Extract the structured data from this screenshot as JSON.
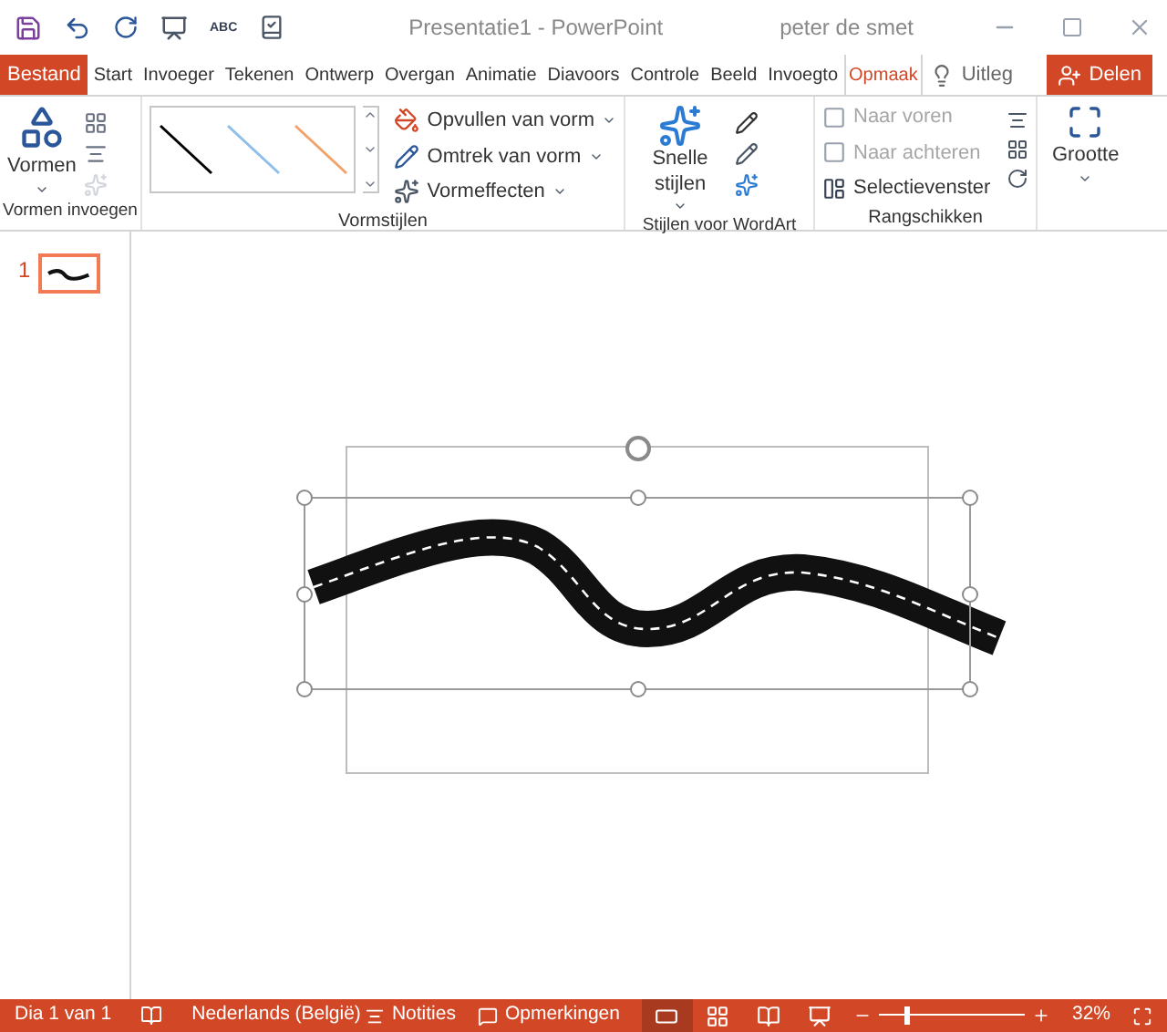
{
  "window": {
    "title": "Presentatie1 - PowerPoint",
    "user": "peter de smet",
    "spelling_label": "ABC"
  },
  "tabs": [
    {
      "label": "Bestand",
      "kind": "file",
      "selected": false
    },
    {
      "label": "Start",
      "kind": "tab",
      "selected": false
    },
    {
      "label": "Invoeger",
      "kind": "tab",
      "selected": false
    },
    {
      "label": "Tekenen",
      "kind": "tab",
      "selected": false
    },
    {
      "label": "Ontwerp",
      "kind": "tab",
      "selected": false
    },
    {
      "label": "Overgan",
      "kind": "tab",
      "selected": false
    },
    {
      "label": "Animatie",
      "kind": "tab",
      "selected": false
    },
    {
      "label": "Diavoors",
      "kind": "tab",
      "selected": false
    },
    {
      "label": "Controle",
      "kind": "tab",
      "selected": false
    },
    {
      "label": "Beeld",
      "kind": "tab",
      "selected": false
    },
    {
      "label": "Invoegto",
      "kind": "tab",
      "selected": false
    },
    {
      "label": "Opmaak",
      "kind": "tab",
      "selected": true
    },
    {
      "label": "Uitleg",
      "kind": "tell",
      "selected": false
    }
  ],
  "share_button": "Delen",
  "ribbon": {
    "insert_shapes": {
      "label": "Vormen invoegen",
      "shapes_button": "Vormen"
    },
    "shape_styles": {
      "label": "Vormstijlen",
      "gallery": [
        {
          "color": "#000000"
        },
        {
          "color": "#8fbfe8"
        },
        {
          "color": "#f2a36b"
        }
      ],
      "commands": [
        {
          "label": "Opvullen van vorm",
          "kind": "fill"
        },
        {
          "label": "Omtrek van vorm",
          "kind": "outline"
        },
        {
          "label": "Vormeffecten",
          "kind": "effects"
        }
      ]
    },
    "wordart_styles": {
      "label": "Stijlen voor WordArt",
      "quick_styles": "Snelle stijlen"
    },
    "arrange": {
      "label": "Rangschikken",
      "commands": [
        {
          "label": "Naar voren",
          "kind": "forward",
          "disabled": true
        },
        {
          "label": "Naar achteren",
          "kind": "backward",
          "disabled": true
        },
        {
          "label": "Selectievenster",
          "kind": "pane",
          "disabled": false
        }
      ]
    },
    "size": {
      "label": "Grootte"
    }
  },
  "slides": [
    {
      "number": "1",
      "selected": true
    }
  ],
  "status_bar": {
    "slide": "Dia 1 van 1",
    "language": "Nederlands (België)",
    "notes": "Notities",
    "comments": "Opmerkingen",
    "views": [
      {
        "kind": "normal",
        "selected": true
      },
      {
        "kind": "sorter",
        "selected": false
      },
      {
        "kind": "reading",
        "selected": false
      },
      {
        "kind": "slideshow",
        "selected": false
      }
    ],
    "zoom": {
      "level": 0.17,
      "reading": "32%"
    }
  }
}
